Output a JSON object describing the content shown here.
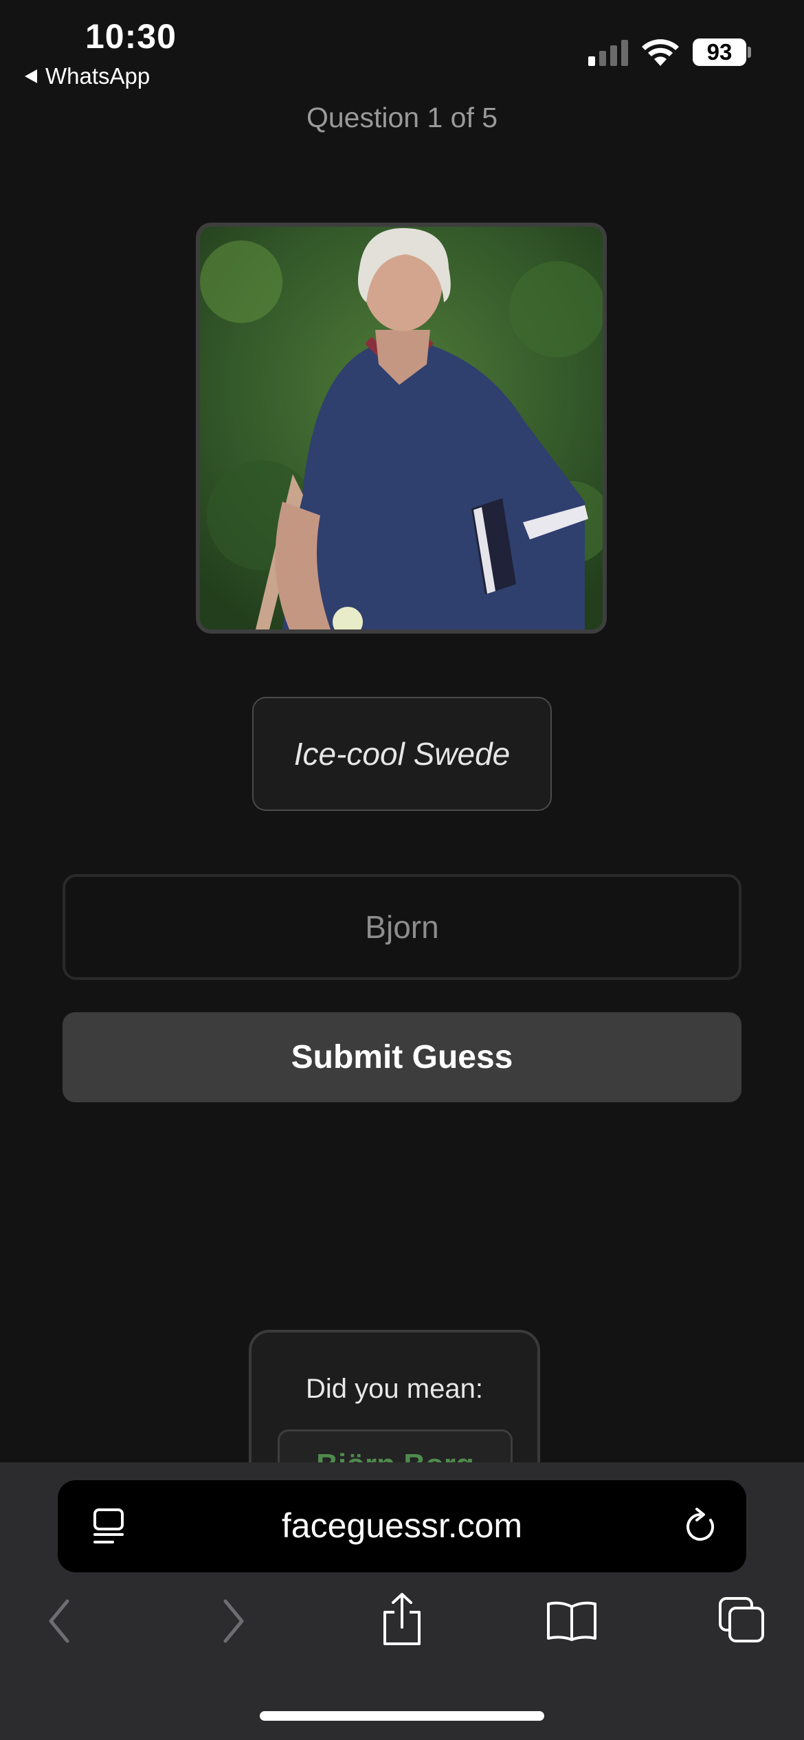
{
  "status_bar": {
    "time": "10:30",
    "back_app": "WhatsApp",
    "battery": "93"
  },
  "quiz": {
    "progress": "Question 1 of 5",
    "hint": "Ice-cool Swede",
    "input_value": "",
    "input_placeholder": "Bjorn",
    "submit_label": "Submit Guess",
    "suggestion_title": "Did you mean:",
    "suggestion_option": "Björn Borg"
  },
  "browser": {
    "url": "faceguessr.com"
  },
  "colors": {
    "background": "#131313",
    "button": "#3d3d3d",
    "suggestion_text": "#4f8a4d",
    "toolbar": "#2c2c2e"
  },
  "icons": [
    "back-triangle-icon",
    "cellular-signal-icon",
    "wifi-icon",
    "battery-icon",
    "tab-overview-icon",
    "reload-icon",
    "back-arrow-icon",
    "forward-arrow-icon",
    "share-icon",
    "bookmarks-icon",
    "tabs-icon"
  ]
}
